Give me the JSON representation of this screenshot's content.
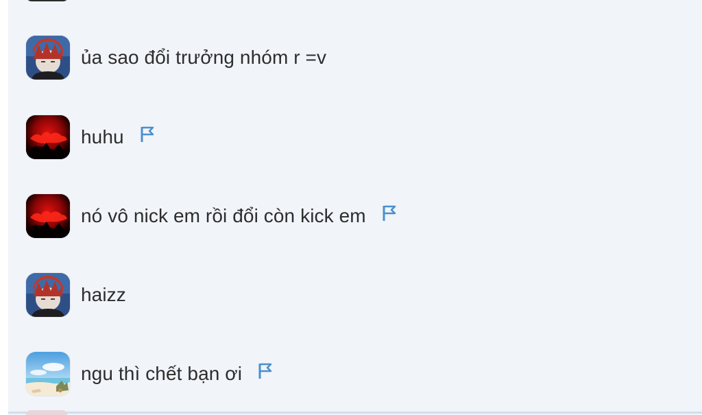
{
  "messages": [
    {
      "avatar": "anime-boy-red-hair-avatar",
      "text": "ủa sao đổi trưởng nhóm r =v",
      "flagged": false
    },
    {
      "avatar": "red-cloud-avatar",
      "text": "huhu",
      "flagged": true
    },
    {
      "avatar": "red-cloud-avatar",
      "text": "nó vô nick em rồi đổi còn kick em",
      "flagged": true
    },
    {
      "avatar": "anime-boy-red-hair-avatar",
      "text": "haizz",
      "flagged": false
    },
    {
      "avatar": "beach-scene-avatar",
      "text": "ngu thì chết bạn ơi",
      "flagged": true
    }
  ],
  "icons": {
    "report": "flag-icon"
  },
  "colors": {
    "background": "#f1f4f9",
    "text": "#2d2d2d",
    "flag": "#4a8fd0"
  }
}
